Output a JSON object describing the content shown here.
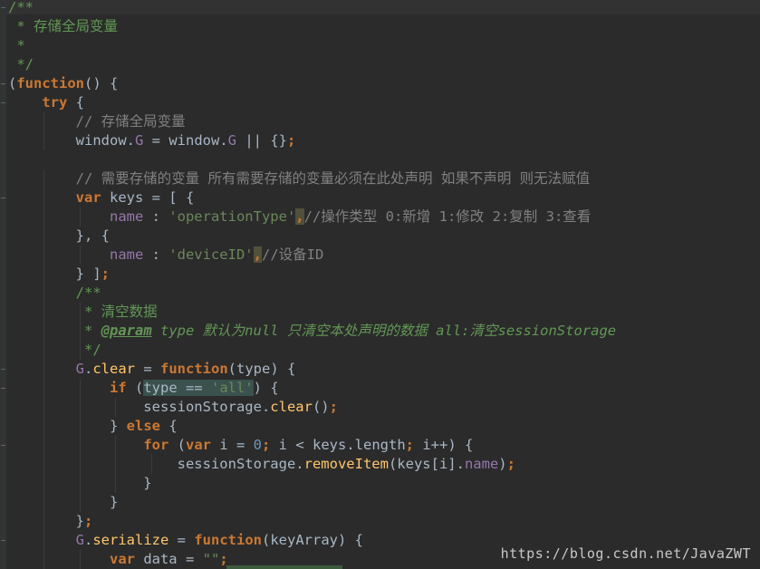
{
  "lines": [
    [
      {
        "t": "/**",
        "c": "doc plain"
      }
    ],
    [
      {
        "t": " * 存储全局变量",
        "c": "doc plain"
      }
    ],
    [
      {
        "t": " *",
        "c": "doc plain"
      }
    ],
    [
      {
        "t": " */",
        "c": "doc plain"
      }
    ],
    [
      {
        "t": "(",
        "c": ""
      },
      {
        "t": "function",
        "c": "kw"
      },
      {
        "t": "() {",
        "c": ""
      }
    ],
    [
      {
        "t": "    ",
        "c": ""
      },
      {
        "t": "try",
        "c": "kw"
      },
      {
        "t": " {",
        "c": ""
      }
    ],
    [
      {
        "t": "        ",
        "c": ""
      },
      {
        "t": "// 存储全局变量",
        "c": "cmt"
      }
    ],
    [
      {
        "t": "        window.",
        "c": ""
      },
      {
        "t": "G",
        "c": "prop"
      },
      {
        "t": " = window.",
        "c": ""
      },
      {
        "t": "G",
        "c": "prop"
      },
      {
        "t": " || {}",
        "c": ""
      },
      {
        "t": ";",
        "c": "kw"
      }
    ],
    [
      {
        "t": "",
        "c": ""
      }
    ],
    [
      {
        "t": "        ",
        "c": ""
      },
      {
        "t": "// 需要存储的变量 所有需要存储的变量必须在此处声明 如果不声明 则无法赋值",
        "c": "cmt"
      }
    ],
    [
      {
        "t": "        ",
        "c": ""
      },
      {
        "t": "var",
        "c": "kw"
      },
      {
        "t": " keys = [ {",
        "c": ""
      }
    ],
    [
      {
        "t": "            ",
        "c": ""
      },
      {
        "t": "name",
        "c": "prop"
      },
      {
        "t": " : ",
        "c": ""
      },
      {
        "t": "'operationType'",
        "c": "str"
      },
      {
        "t": ",",
        "c": "kw warn"
      },
      {
        "t": "//操作类型 0:新增 1:修改 2:复制 3:查看",
        "c": "cmt"
      }
    ],
    [
      {
        "t": "        }, {",
        "c": ""
      }
    ],
    [
      {
        "t": "            ",
        "c": ""
      },
      {
        "t": "name",
        "c": "prop"
      },
      {
        "t": " : ",
        "c": ""
      },
      {
        "t": "'deviceID'",
        "c": "str"
      },
      {
        "t": ",",
        "c": "kw warn"
      },
      {
        "t": "//设备ID",
        "c": "cmt"
      }
    ],
    [
      {
        "t": "        } ]",
        "c": ""
      },
      {
        "t": ";",
        "c": "kw"
      }
    ],
    [
      {
        "t": "        ",
        "c": ""
      },
      {
        "t": "/**",
        "c": "doc plain"
      }
    ],
    [
      {
        "t": "         ",
        "c": ""
      },
      {
        "t": "* 清空数据",
        "c": "doc plain"
      }
    ],
    [
      {
        "t": "         ",
        "c": ""
      },
      {
        "t": "* ",
        "c": "doc"
      },
      {
        "t": "@param",
        "c": "tag"
      },
      {
        "t": " type 默认为null 只清空本处声明的数据 all:清空sessionStorage",
        "c": "doc"
      }
    ],
    [
      {
        "t": "         ",
        "c": ""
      },
      {
        "t": "*/",
        "c": "doc plain"
      }
    ],
    [
      {
        "t": "        ",
        "c": ""
      },
      {
        "t": "G",
        "c": "prop"
      },
      {
        "t": ".",
        "c": ""
      },
      {
        "t": "clear",
        "c": "fn"
      },
      {
        "t": " = ",
        "c": ""
      },
      {
        "t": "function",
        "c": "kw"
      },
      {
        "t": "(type) {",
        "c": ""
      }
    ],
    [
      {
        "t": "            ",
        "c": ""
      },
      {
        "t": "if",
        "c": "kw"
      },
      {
        "t": " (",
        "c": ""
      },
      {
        "t": "type == ",
        "c": "hl"
      },
      {
        "t": "'all'",
        "c": "str hl"
      },
      {
        "t": ") {",
        "c": ""
      }
    ],
    [
      {
        "t": "                sessionStorage.",
        "c": ""
      },
      {
        "t": "clear",
        "c": "fn"
      },
      {
        "t": "()",
        "c": ""
      },
      {
        "t": ";",
        "c": "kw"
      }
    ],
    [
      {
        "t": "            } ",
        "c": ""
      },
      {
        "t": "else",
        "c": "kw"
      },
      {
        "t": " {",
        "c": ""
      }
    ],
    [
      {
        "t": "                ",
        "c": ""
      },
      {
        "t": "for",
        "c": "kw"
      },
      {
        "t": " (",
        "c": ""
      },
      {
        "t": "var",
        "c": "kw"
      },
      {
        "t": " i = ",
        "c": ""
      },
      {
        "t": "0",
        "c": "num"
      },
      {
        "t": "; ",
        "c": "kw"
      },
      {
        "t": "i < keys.length",
        "c": ""
      },
      {
        "t": "; ",
        "c": "kw"
      },
      {
        "t": "i++) {",
        "c": ""
      }
    ],
    [
      {
        "t": "                    sessionStorage.",
        "c": ""
      },
      {
        "t": "removeItem",
        "c": "fn"
      },
      {
        "t": "(keys[i].",
        "c": ""
      },
      {
        "t": "name",
        "c": "prop"
      },
      {
        "t": ")",
        "c": ""
      },
      {
        "t": ";",
        "c": "kw"
      }
    ],
    [
      {
        "t": "                }",
        "c": ""
      }
    ],
    [
      {
        "t": "            }",
        "c": ""
      }
    ],
    [
      {
        "t": "        }",
        "c": ""
      },
      {
        "t": ";",
        "c": "kw"
      }
    ],
    [
      {
        "t": "        ",
        "c": ""
      },
      {
        "t": "G",
        "c": "prop"
      },
      {
        "t": ".",
        "c": ""
      },
      {
        "t": "serialize",
        "c": "fn"
      },
      {
        "t": " = ",
        "c": ""
      },
      {
        "t": "function",
        "c": "kw"
      },
      {
        "t": "(keyArray) {",
        "c": ""
      }
    ],
    [
      {
        "t": "            ",
        "c": ""
      },
      {
        "t": "var",
        "c": "kw"
      },
      {
        "t": " data = ",
        "c": ""
      },
      {
        "t": "\"\"",
        "c": "str"
      },
      {
        "t": ";",
        "c": "kw"
      }
    ]
  ],
  "watermark": "https://blog.csdn.net/JavaZWT"
}
